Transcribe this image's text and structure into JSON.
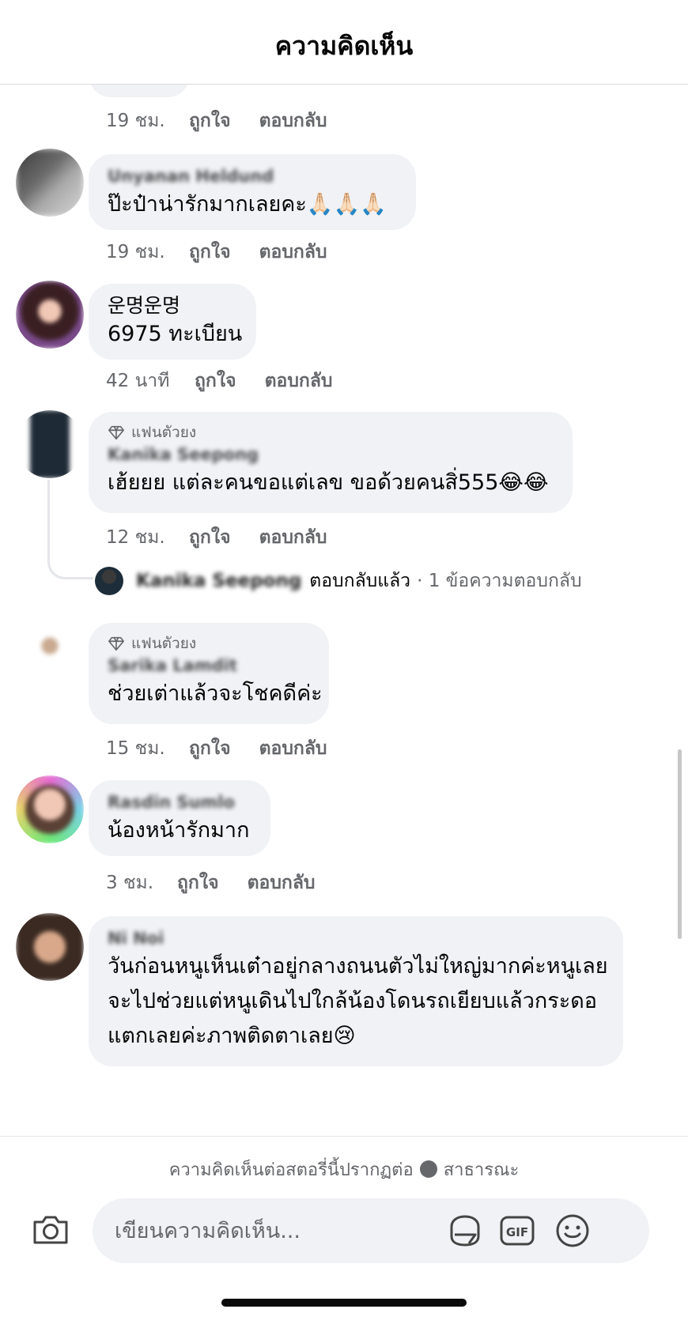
{
  "header": {
    "title": "ความคิดเห็น"
  },
  "comments": [
    {
      "author": "",
      "text": "",
      "time": "19 ชม.",
      "like": "ถูกใจ",
      "reply": "ตอบกลับ"
    },
    {
      "author": "Unyanan Heldund",
      "text": "ป๊ะป๋าน่ารักมากเลยคะ🙏🏻🙏🏻🙏🏻",
      "time": "19 ชม.",
      "like": "ถูกใจ",
      "reply": "ตอบกลับ"
    },
    {
      "author": "운명운명",
      "text": "6975 ทะเบียน",
      "time": "42 นาที",
      "like": "ถูกใจ",
      "reply": "ตอบกลับ"
    },
    {
      "badge": "แฟนตัวยง",
      "author": "Kanika Seepong",
      "text": "เฮ้ยยย แต่ละคนขอแต่เลข ขอด้วยคนสิ่555😂😂",
      "time": "12 ชม.",
      "like": "ถูกใจ",
      "reply": "ตอบกลับ",
      "reply_summary": {
        "name": "Kanika Seepong",
        "action": "ตอบกลับแล้ว",
        "count": "· 1 ข้อความตอบกลับ"
      }
    },
    {
      "badge": "แฟนตัวยง",
      "author": "Sarika Lamdit",
      "text": "ช่วยเต่าแล้วจะโชคดีค่ะ",
      "time": "15 ชม.",
      "like": "ถูกใจ",
      "reply": "ตอบกลับ"
    },
    {
      "author": "Rasdin Sumlo",
      "text": "น้องหน้ารักมาก",
      "time": "3 ชม.",
      "like": "ถูกใจ",
      "reply": "ตอบกลับ"
    },
    {
      "author": "Ni Noi",
      "text_lines": [
        "วันก่อนหนูเห็นเต๋าอยู่กลางถนนตัวไม่ใหญ่มากค่ะหนูเลย",
        "จะไปช่วยแต่หนูเดินไปใกล้น้องโดนรถเยียบแล้วกระดอ",
        "แตกเลยค่ะภาพติดตาเลย😢"
      ]
    }
  ],
  "footer": {
    "public_note_before": "ความคิดเห็นต่อสตอรี่นี้ปรากฏต่อ",
    "public_note_after": "สาธารณะ",
    "composer_placeholder": "เขียนความคิดเห็น..."
  },
  "icons": [
    "camera-icon",
    "sticker-icon",
    "gif-icon",
    "emoji-icon",
    "diamond-icon",
    "globe-icon"
  ],
  "colors": {
    "bubble": "#f0f2f5",
    "muted": "#65676b",
    "text": "#050505"
  }
}
